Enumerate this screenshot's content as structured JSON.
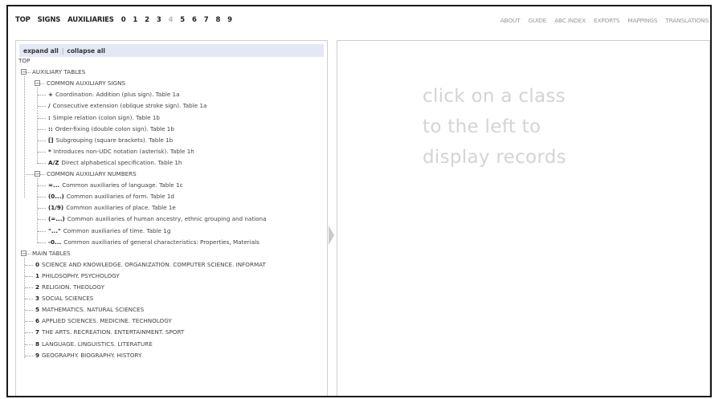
{
  "top_nav": {
    "left_items": [
      "TOP",
      "SIGNS",
      "AUXILIARIES",
      "0",
      "1",
      "2",
      "3",
      "4",
      "5",
      "6",
      "7",
      "8",
      "9"
    ],
    "dim_item": "4",
    "right_items": [
      "ABOUT",
      "GUIDE",
      "ABC INDEX",
      "EXPORTS",
      "MAPPINGS",
      "TRANSLATIONS"
    ]
  },
  "toolbar": {
    "expand_label": "expand all",
    "collapse_label": "collapse all"
  },
  "tree": {
    "root": "TOP",
    "aux_tables": "AUXILIARY TABLES",
    "common_signs": "COMMON AUXILIARY SIGNS",
    "signs": [
      {
        "code": "+",
        "label": "Coordination. Addition (plus sign). Table 1a"
      },
      {
        "code": "/",
        "label": "Consecutive extension (oblique stroke sign). Table 1a"
      },
      {
        "code": ":",
        "label": "Simple relation (colon sign). Table 1b"
      },
      {
        "code": "::",
        "label": "Order-fixing (double colon sign). Table 1b"
      },
      {
        "code": "[]",
        "label": "Subgrouping (square brackets). Table 1b"
      },
      {
        "code": "*",
        "label": "Introduces non-UDC notation (asterisk). Table 1h"
      },
      {
        "code": "A/Z",
        "label": "Direct alphabetical specification. Table 1h"
      }
    ],
    "common_numbers": "COMMON AUXILIARY NUMBERS",
    "numbers": [
      {
        "code": "=...",
        "label": "Common auxiliaries of language. Table 1c"
      },
      {
        "code": "(0...)",
        "label": "Common auxiliaries of form. Table 1d"
      },
      {
        "code": "(1/9)",
        "label": "Common auxiliaries of place. Table 1e"
      },
      {
        "code": "(=...)",
        "label": "Common auxiliaries of human ancestry, ethnic grouping and nationa"
      },
      {
        "code": "\"...\"",
        "label": "Common auxiliaries of time. Table 1g"
      },
      {
        "code": "-0...",
        "label": "Common auxiliaries of general characteristics: Properties, Materials"
      }
    ],
    "main_tables": "MAIN TABLES",
    "mains": [
      {
        "code": "0",
        "label": "SCIENCE AND KNOWLEDGE. ORGANIZATION. COMPUTER SCIENCE. INFORMAT"
      },
      {
        "code": "1",
        "label": "PHILOSOPHY. PSYCHOLOGY"
      },
      {
        "code": "2",
        "label": "RELIGION. THEOLOGY"
      },
      {
        "code": "3",
        "label": "SOCIAL SCIENCES"
      },
      {
        "code": "5",
        "label": "MATHEMATICS. NATURAL SCIENCES"
      },
      {
        "code": "6",
        "label": "APPLIED SCIENCES. MEDICINE. TECHNOLOGY"
      },
      {
        "code": "7",
        "label": "THE ARTS. RECREATION. ENTERTAINMENT. SPORT"
      },
      {
        "code": "8",
        "label": "LANGUAGE. LINGUISTICS. LITERATURE"
      },
      {
        "code": "9",
        "label": "GEOGRAPHY. BIOGRAPHY. HISTORY"
      }
    ]
  },
  "records": {
    "hint": "click on a class\nto the left to\ndisplay records"
  }
}
